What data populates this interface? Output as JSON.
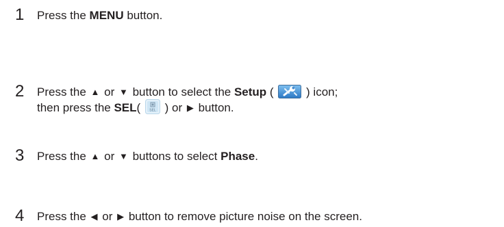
{
  "steps": [
    {
      "number": "1",
      "text_a": "Press the ",
      "bold_a": "MENU",
      "text_b": " button."
    },
    {
      "number": "2",
      "line1": {
        "text_a": "Press the ",
        "up_glyph": "▲",
        "text_b": " or ",
        "down_glyph": "▼",
        "text_c": " button to select the ",
        "bold_a": "Setup",
        "text_d": " ( ",
        "setup_icon_name": "setup-wrench-icon",
        "text_e": " ) icon;"
      },
      "line2": {
        "text_a": "then press the ",
        "bold_a": "SEL",
        "text_b": "( ",
        "sel_icon_name": "sel-button-icon",
        "sel_icon_label": "SEL",
        "text_c": " ) or ",
        "right_glyph": "▶",
        "text_d": " button."
      }
    },
    {
      "number": "3",
      "text_a": "Press the ",
      "up_glyph": "▲",
      "text_b": " or ",
      "down_glyph": "▼",
      "text_c": " buttons to select ",
      "bold_a": "Phase",
      "text_d": "."
    },
    {
      "number": "4",
      "text_a": "Press the ",
      "left_glyph": "◀",
      "text_b": " or ",
      "right_glyph": "▶",
      "text_c": " button to remove picture noise on the screen."
    }
  ],
  "colors": {
    "text": "#231f20",
    "setup_icon_bg": "#3a8fd8",
    "sel_icon_bg": "#cfe6f5"
  }
}
